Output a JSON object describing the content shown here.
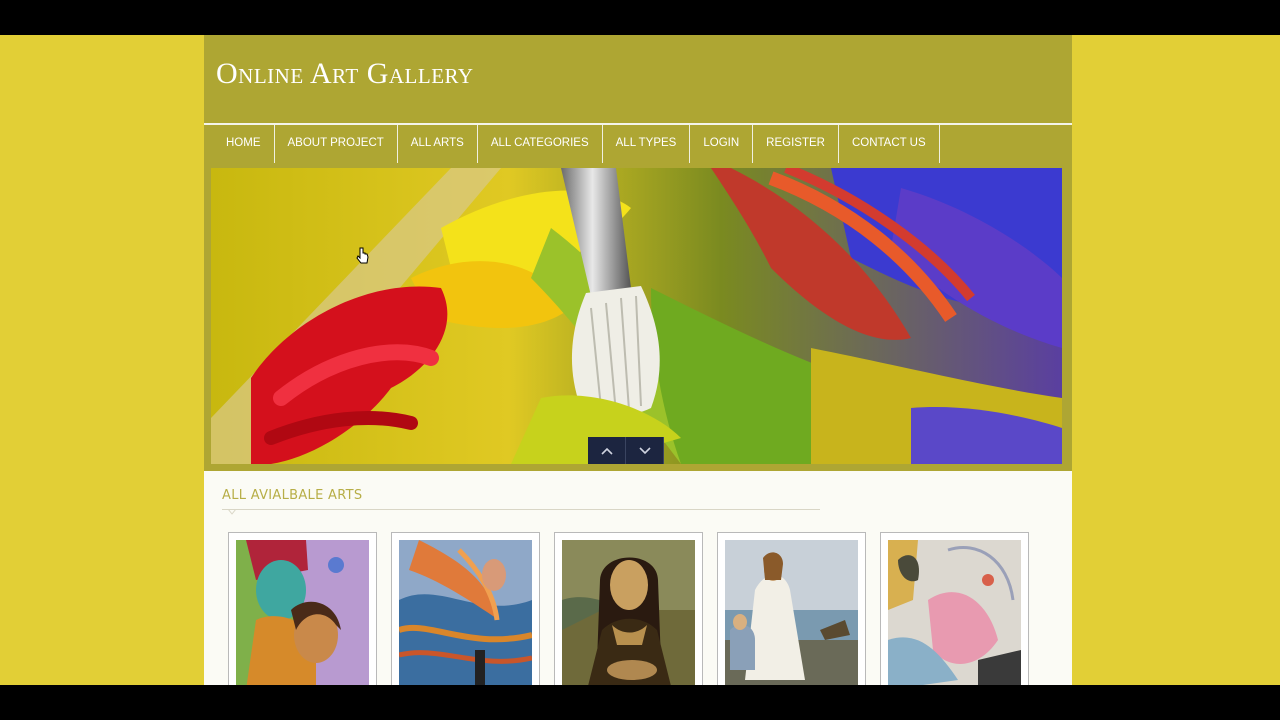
{
  "site": {
    "title": "Online Art Gallery"
  },
  "nav": {
    "items": [
      {
        "label": "HOME"
      },
      {
        "label": "ABOUT PROJECT"
      },
      {
        "label": "ALL ARTS"
      },
      {
        "label": "ALL CATEGORIES"
      },
      {
        "label": "ALL TYPES"
      },
      {
        "label": "LOGIN"
      },
      {
        "label": "REGISTER"
      },
      {
        "label": "CONTACT US"
      }
    ]
  },
  "hero": {
    "controls": {
      "prev_icon": "chevron-up-icon",
      "next_icon": "chevron-down-icon"
    }
  },
  "section": {
    "title": "ALL AVIALBALE ARTS"
  },
  "colors": {
    "background": "#e2cf36",
    "header": "#aea633",
    "section_title": "#b7ae47",
    "slider_button": "#1c2540"
  }
}
